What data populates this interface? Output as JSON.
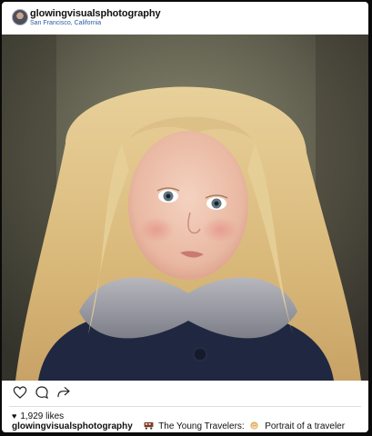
{
  "post": {
    "username": "glowingvisualsphotography",
    "location": "San Francisco, California",
    "likes": "1,929 likes",
    "caption_user": "glowingvisualsphotography",
    "caption_part1": "The Young Travelers:",
    "caption_part2": "Portrait of a traveler",
    "photo_subject": "portrait of a young blonde girl in a navy coat with a gray fur collar"
  },
  "icons": {
    "like": "heart-outline-icon",
    "comment": "comment-bubble-icon",
    "share": "share-arrow-icon",
    "likes_heart": "heart-filled-icon",
    "emoji_1": "train-emoji-icon",
    "emoji_2": "girl-emoji-icon"
  },
  "colors": {
    "location_link": "#2b5aa8",
    "coat": "#1f2840",
    "hair": "#e0c58e"
  }
}
